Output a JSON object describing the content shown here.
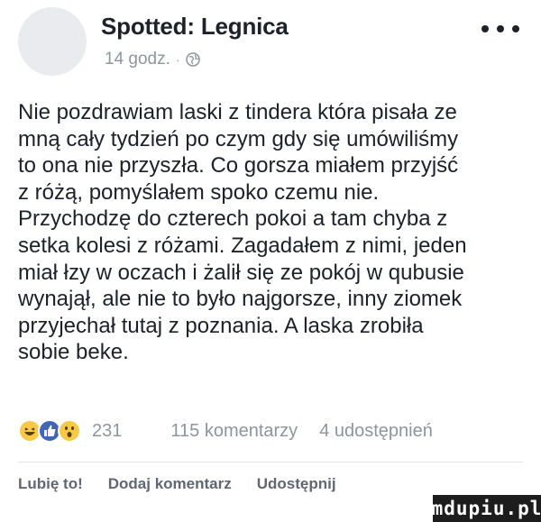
{
  "header": {
    "page_name": "Spotted: Legnica",
    "time": "14 godz.",
    "separator": "·",
    "privacy_icon": "globe-icon",
    "more_icon": "more-options-icon"
  },
  "post": {
    "text": "Nie pozdrawiam laski z tindera która pisała ze\nmną cały tydzień po czym gdy się umówiliśmy\nto ona nie przyszła. Co gorsza miałem przyjść\nz różą, pomyślałem spoko czemu nie.\nPrzychodzę do czterech pokoi a tam chyba z\nsetka kolesi z różami. Zagadałem z nimi, jeden\nmiał łzy w oczach i żalił się ze pokój w qubusie\nwynajął, ale nie to było najgorsze, inny ziomek\nprzyjechał tutaj z poznania. A laska zrobiła\nsobie beke."
  },
  "stats": {
    "reactions": [
      "haha",
      "like",
      "wow"
    ],
    "reaction_count": "231",
    "comments": "115 komentarzy",
    "shares": "4 udostępnień"
  },
  "actions": {
    "like": "Lubię to!",
    "comment": "Dodaj komentarz",
    "share": "Udostępnij"
  },
  "watermark": "mdupiu.pl",
  "colors": {
    "text": "#1d2129",
    "secondary": "#90949c",
    "like_blue": "#4267b2",
    "emoji_yellow": "#f7c948"
  }
}
